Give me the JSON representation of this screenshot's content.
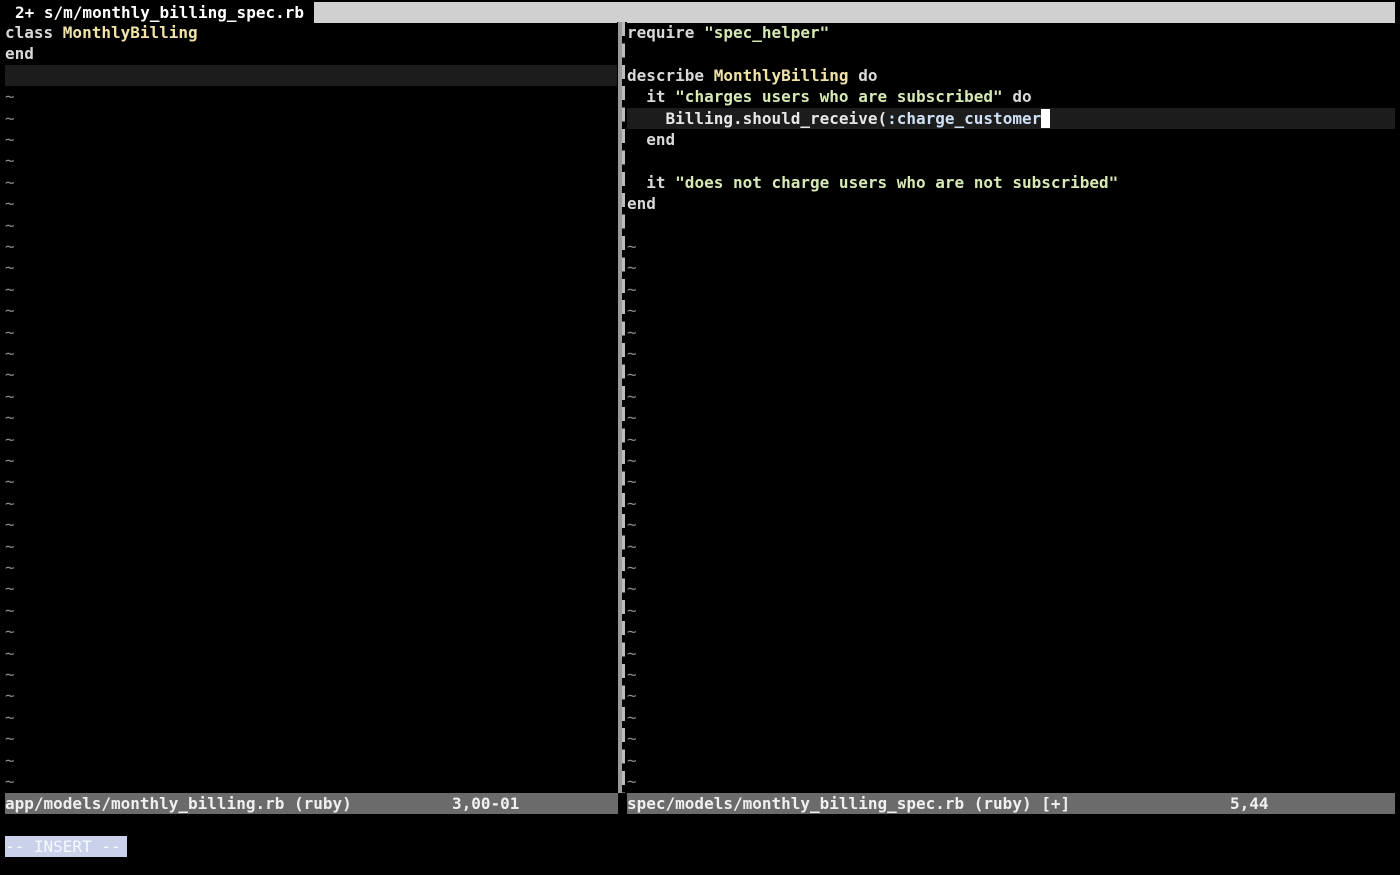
{
  "tabline": {
    "active_tab": "2+ s/m/monthly_billing_spec.rb"
  },
  "left_pane": {
    "lines": [
      {
        "tokens": [
          {
            "t": "class ",
            "c": "kw"
          },
          {
            "t": "MonthlyBilling",
            "c": "cls"
          }
        ]
      },
      {
        "tokens": [
          {
            "t": "end",
            "c": "kw"
          }
        ]
      },
      {
        "tokens": [],
        "cursorline": true
      }
    ],
    "tilde_count": 33
  },
  "right_pane": {
    "lines": [
      {
        "tokens": [
          {
            "t": "require ",
            "c": "kw"
          },
          {
            "t": "\"spec_helper\"",
            "c": "str"
          }
        ]
      },
      {
        "tokens": []
      },
      {
        "tokens": [
          {
            "t": "describe ",
            "c": "kw"
          },
          {
            "t": "MonthlyBilling",
            "c": "cls"
          },
          {
            "t": " do",
            "c": "kw"
          }
        ]
      },
      {
        "tokens": [
          {
            "t": "  it ",
            "c": "kw"
          },
          {
            "t": "\"charges users who are subscribed\"",
            "c": "str"
          },
          {
            "t": " do",
            "c": "kw"
          }
        ]
      },
      {
        "tokens": [
          {
            "t": "    Billing.should_receive(",
            "c": "meth"
          },
          {
            "t": ":charge_customer",
            "c": "sym"
          }
        ],
        "cursorline": true,
        "cursor": true
      },
      {
        "tokens": [
          {
            "t": "  end",
            "c": "kw"
          }
        ]
      },
      {
        "tokens": []
      },
      {
        "tokens": [
          {
            "t": "  it ",
            "c": "kw"
          },
          {
            "t": "\"does not charge users who are not subscribed\"",
            "c": "str"
          }
        ]
      },
      {
        "tokens": [
          {
            "t": "end",
            "c": "kw"
          }
        ]
      },
      {
        "tokens": []
      }
    ],
    "tilde_count": 26
  },
  "status_left": {
    "filename": "app/models/monthly_billing.rb (ruby)",
    "position": "3,00-01"
  },
  "status_right": {
    "filename": "spec/models/monthly_billing_spec.rb (ruby) [+]",
    "position": "5,44"
  },
  "mode_line": "-- INSERT --",
  "tilde_char": "~",
  "colors": {
    "background": "#000000",
    "status_bg": "#6b6b6b",
    "tabline_bg": "#d0d0d0",
    "class_name": "#f1e3a6",
    "string": "#d6e9b4",
    "mode_bg": "#c9d2ea"
  }
}
